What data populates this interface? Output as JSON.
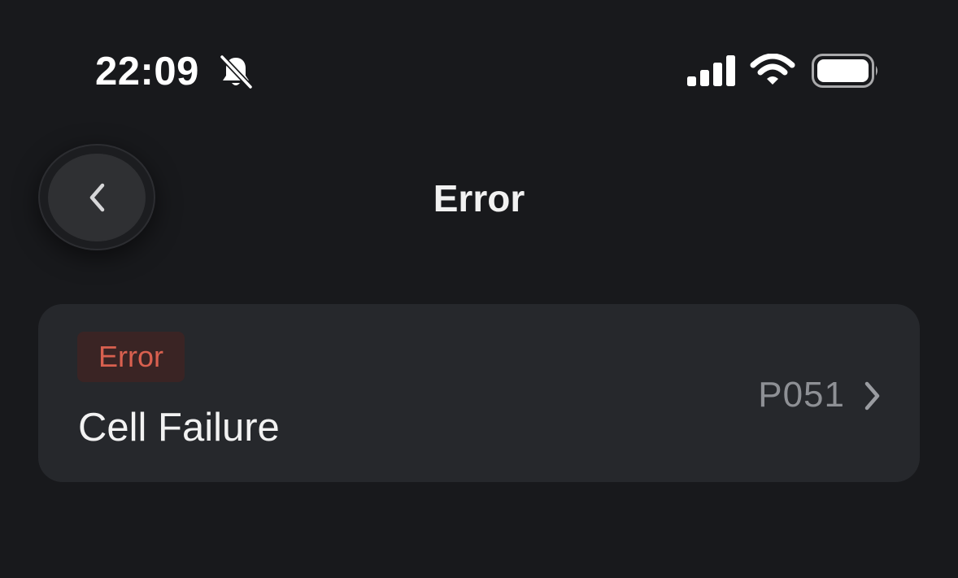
{
  "status_bar": {
    "time": "22:09",
    "icons": [
      "bell-slash-icon",
      "cellular-signal-icon",
      "wifi-icon",
      "battery-icon"
    ]
  },
  "nav": {
    "title": "Error",
    "back_icon": "chevron-left-icon"
  },
  "errors": [
    {
      "badge": "Error",
      "name": "Cell Failure",
      "code": "P051",
      "chevron_icon": "chevron-right-icon"
    }
  ],
  "colors": {
    "background": "#18191c",
    "card": "#26282c",
    "badge_bg": "#3a2424",
    "badge_text": "#d9604f",
    "code_text": "#8e9095"
  }
}
